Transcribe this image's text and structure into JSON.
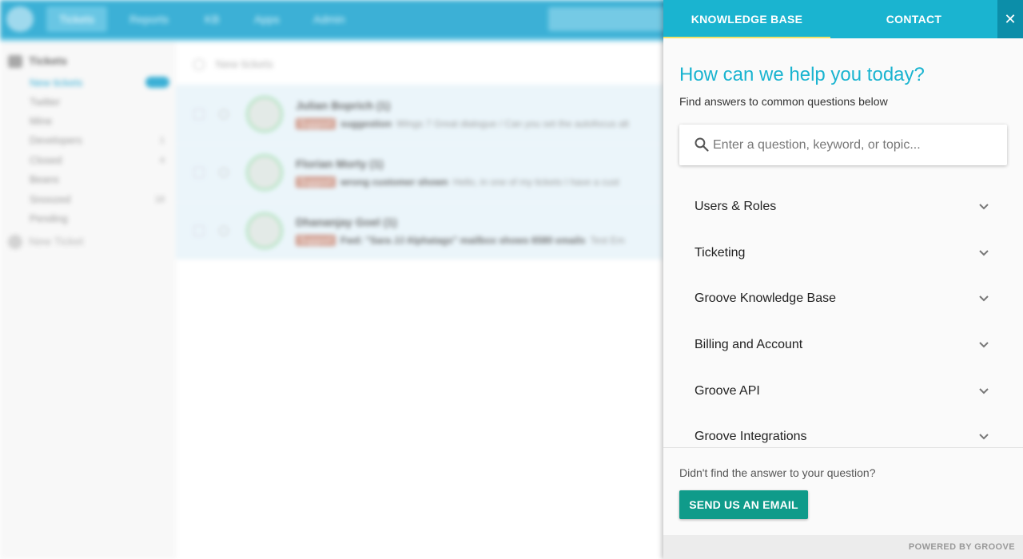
{
  "app": {
    "nav": [
      "Tickets",
      "Reports",
      "KB",
      "Apps",
      "Admin"
    ],
    "sidebar": {
      "heading": "Tickets",
      "items": [
        {
          "label": "New tickets",
          "count": ""
        },
        {
          "label": "Twitter",
          "count": ""
        },
        {
          "label": "Mine",
          "count": ""
        },
        {
          "label": "Developers",
          "count": "1"
        },
        {
          "label": "Closed",
          "count": "4"
        },
        {
          "label": "Beans",
          "count": ""
        },
        {
          "label": "Snoozed",
          "count": "18"
        },
        {
          "label": "Pending",
          "count": ""
        }
      ],
      "new_ticket": "New Ticket"
    },
    "list_heading": "New tickets",
    "rows": [
      {
        "name": "Julian Boprich (1)",
        "tag": "Support",
        "subject": "suggestion",
        "snippet": "Wings 7 Great dialogue / Can you set the autofocus alt"
      },
      {
        "name": "Florian Morty (1)",
        "tag": "Support",
        "subject": "wrong customer shown",
        "snippet": "Hello, in one of my tickets I have a cust"
      },
      {
        "name": "Dhananjay Goel (1)",
        "tag": "Support",
        "subject": "Fwd: \"Sara JJ Alphatags\" mailbox shows 6580 emails",
        "snippet": "Test Em"
      }
    ]
  },
  "widget": {
    "tabs": {
      "knowledge_base": "KNOWLEDGE BASE",
      "contact": "CONTACT"
    },
    "close_symbol": "✕",
    "title": "How can we help you today?",
    "subtitle": "Find answers to common questions below",
    "search": {
      "placeholder": "Enter a question, keyword, or topic...",
      "value": ""
    },
    "topics": [
      "Users & Roles",
      "Ticketing",
      "Groove Knowledge Base",
      "Billing and Account",
      "Groove API",
      "Groove Integrations"
    ],
    "footer": {
      "prompt": "Didn't find the answer to your question?",
      "button": "SEND US AN EMAIL"
    },
    "powered_by": "POWERED BY GROOVE",
    "colors": {
      "accent": "#1ab4d0",
      "tab_underline": "#f3e36b",
      "button": "#0f9b8a",
      "close": "#0c8ea9"
    }
  }
}
